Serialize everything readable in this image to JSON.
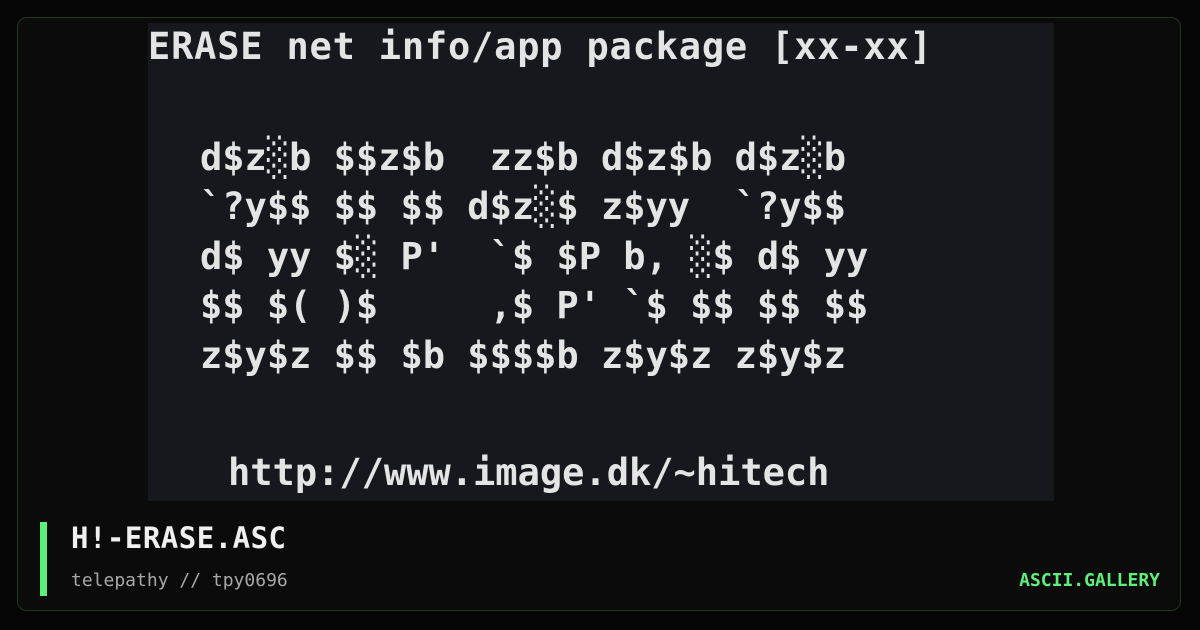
{
  "artwork": {
    "lines": [
      "ERASE net info/app package [xx-xx]",
      "d$z░b $$z$b  zz$b d$z$b d$z░b",
      "`?y$$ $$ $$ d$z░$ z$yy  `?y$$",
      "d$ yy $░ P'  `$ $P b, ░$ d$ yy",
      "$$ $( )$     ,$ P' `$ $$ $$ $$",
      "z$y$z $$ $b $$$$b z$y$z z$y$z",
      "http://www.image.dk/~hitech"
    ]
  },
  "footer": {
    "title": "H!-ERASE.ASC",
    "subtitle": "telepathy // tpy0696",
    "brand": "ASCII.GALLERY"
  },
  "colors": {
    "accent": "#5ef07a",
    "art_text": "#e4e4e4",
    "art_background": "#16181d"
  }
}
